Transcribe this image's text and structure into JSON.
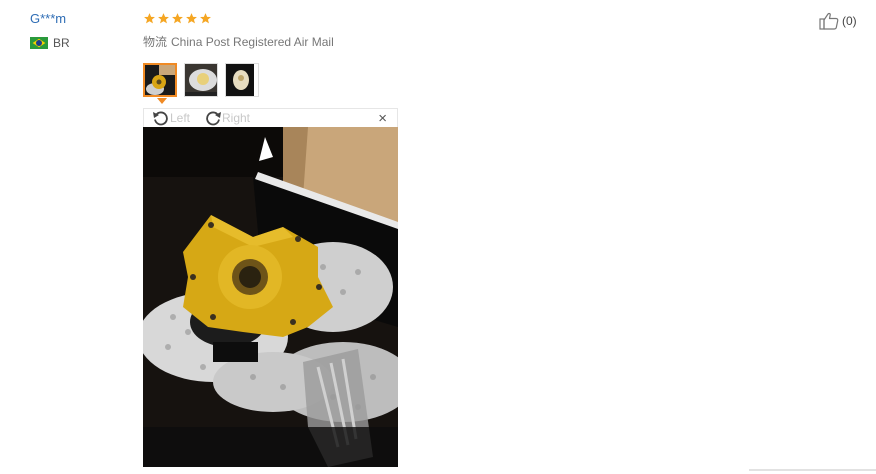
{
  "review": {
    "username": "G***m",
    "country_code": "BR",
    "rating": {
      "stars": 5,
      "max": 5
    },
    "shipping_label": "物流",
    "shipping_method": "China Post Registered Air Mail",
    "helpful_count": "(0)",
    "photos_count": 3
  },
  "viewer": {
    "rotate_left": "Left",
    "rotate_right": "Right",
    "close": "×"
  },
  "colors": {
    "username": "#2f6db5",
    "star": "#f5a623",
    "active_border": "#f08a24"
  },
  "icons": [
    "brazil-flag-icon",
    "star-icon",
    "thumbs-up-icon",
    "rotate-left-icon",
    "rotate-right-icon",
    "close-icon"
  ]
}
